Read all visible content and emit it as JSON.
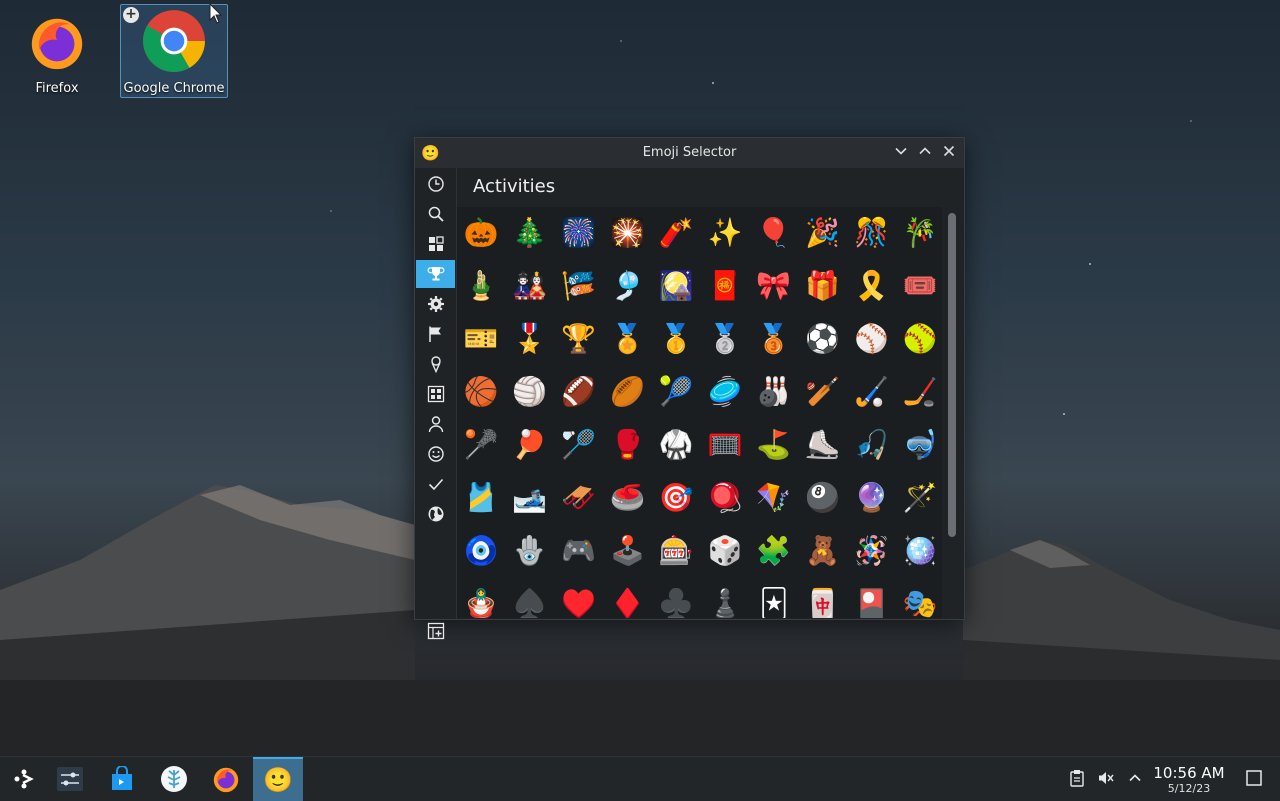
{
  "desktop": {
    "icons": [
      {
        "label": "Firefox"
      },
      {
        "label": "Google Chrome"
      }
    ]
  },
  "window": {
    "title": "Emoji Selector",
    "app_icon": "🙂",
    "controls": {
      "minimize": "⌄",
      "maximize": "⌃",
      "close": "✕"
    },
    "category_title": "Activities",
    "sidebar": [
      {
        "icon": "clock-icon"
      },
      {
        "icon": "search-icon"
      },
      {
        "icon": "grid-icon"
      },
      {
        "icon": "trophy-icon",
        "active": true
      },
      {
        "icon": "gear-icon"
      },
      {
        "icon": "flag-icon"
      },
      {
        "icon": "ice-cream-icon"
      },
      {
        "icon": "symbols-icon"
      },
      {
        "icon": "person-icon"
      },
      {
        "icon": "smiley-icon"
      },
      {
        "icon": "checkmark-icon"
      },
      {
        "icon": "globe-icon"
      },
      {
        "icon": "table-add-icon"
      }
    ],
    "emojis": [
      [
        "🎃",
        "🎄",
        "🎆",
        "🎇",
        "🧨",
        "✨",
        "🎈",
        "🎉",
        "🎊",
        "🎋"
      ],
      [
        "🎍",
        "🎎",
        "🎏",
        "🎐",
        "🎑",
        "🧧",
        "🎀",
        "🎁",
        "🎗️",
        "🎟️"
      ],
      [
        "🎫",
        "🎖️",
        "🏆",
        "🏅",
        "🥇",
        "🥈",
        "🥉",
        "⚽",
        "⚾",
        "🥎"
      ],
      [
        "🏀",
        "🏐",
        "🏈",
        "🏉",
        "🎾",
        "🥏",
        "🎳",
        "🏏",
        "🏑",
        "🏒"
      ],
      [
        "🥍",
        "🏓",
        "🏸",
        "🥊",
        "🥋",
        "🥅",
        "⛳",
        "⛸️",
        "🎣",
        "🤿"
      ],
      [
        "🎽",
        "🎿",
        "🛷",
        "🥌",
        "🎯",
        "🪀",
        "🪁",
        "🎱",
        "🔮",
        "🪄"
      ],
      [
        "🧿",
        "🪬",
        "🎮",
        "🕹️",
        "🎰",
        "🎲",
        "🧩",
        "🧸",
        "🪅",
        "🪩"
      ],
      [
        "🪆",
        "♠️",
        "♥️",
        "♦️",
        "♣️",
        "♟️",
        "🃏",
        "🀄",
        "🎴",
        "🎭"
      ]
    ]
  },
  "taskbar": {
    "apps": [
      {
        "icon": "app-launcher-icon",
        "glyph": "❖"
      },
      {
        "icon": "settings-sliders-icon",
        "glyph": "☰"
      },
      {
        "icon": "discover-store-icon",
        "glyph": "🛍"
      },
      {
        "icon": "flatpak-app-icon",
        "glyph": "❄"
      },
      {
        "icon": "firefox-icon",
        "glyph": "🦊"
      },
      {
        "icon": "emoji-selector-icon",
        "glyph": "🙂",
        "active": true
      }
    ],
    "tray": [
      {
        "icon": "clipboard-icon"
      },
      {
        "icon": "volume-muted-icon"
      },
      {
        "icon": "expand-tray-icon"
      }
    ],
    "clock": {
      "time": "10:56 AM",
      "date": "5/12/23"
    },
    "show_desktop_icon": "show-desktop-icon"
  }
}
